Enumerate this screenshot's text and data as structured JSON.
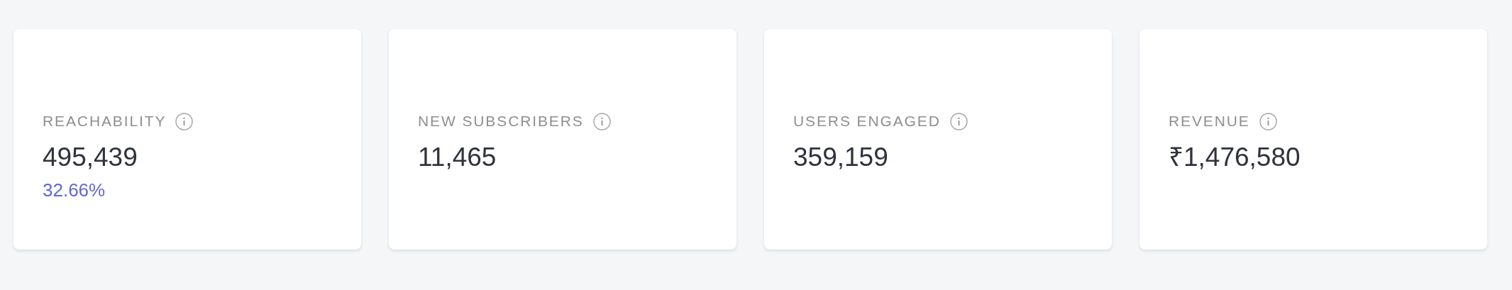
{
  "cards": [
    {
      "label": "REACHABILITY",
      "value": "495,439",
      "change": "32.66%"
    },
    {
      "label": "NEW SUBSCRIBERS",
      "value": "11,465"
    },
    {
      "label": "USERS ENGAGED",
      "value": "359,159"
    },
    {
      "label": "REVENUE",
      "value": "₹1,476,580"
    }
  ]
}
